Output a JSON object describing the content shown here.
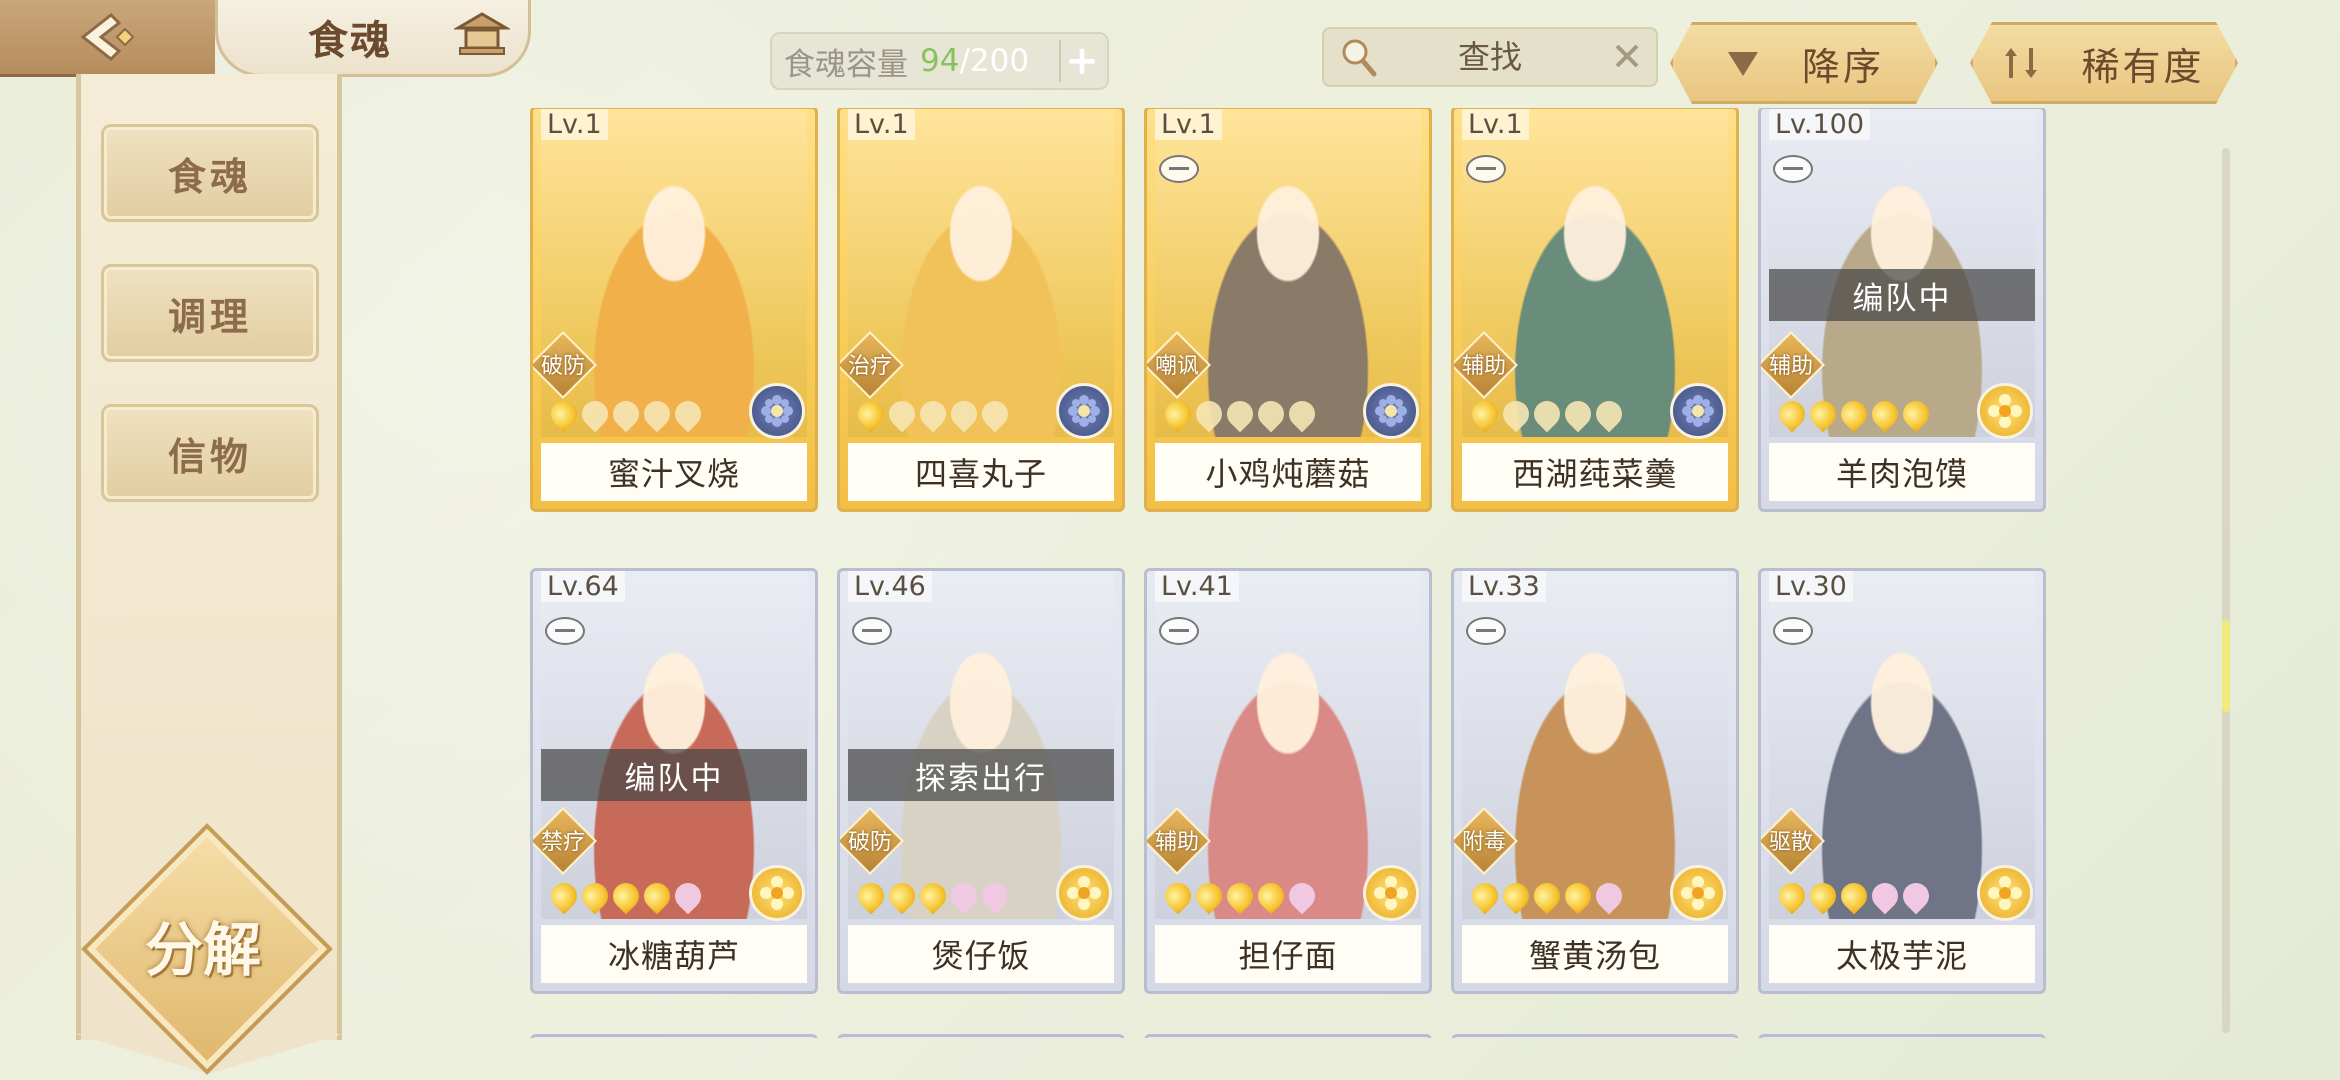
{
  "header": {
    "title": "食魂",
    "capacity_label": "食魂容量",
    "capacity_current": "94",
    "capacity_sep": "/",
    "capacity_max": "200",
    "plus_label": "+",
    "search_placeholder": "查找",
    "sort_desc_label": "降序",
    "sort_rarity_label": "稀有度"
  },
  "sidebar": {
    "tabs": [
      {
        "label": "食魂",
        "active": true
      },
      {
        "label": "调理",
        "active": false
      },
      {
        "label": "信物",
        "active": false
      }
    ],
    "decompose_label": "分解"
  },
  "cards": [
    {
      "level": "Lv.1",
      "name": "蜜汁叉烧",
      "role": "破防",
      "frame": "gold",
      "stars_on": 1,
      "stars_total": 5,
      "element": "blue",
      "status": "",
      "skin": false,
      "art": "#f2b04a"
    },
    {
      "level": "Lv.1",
      "name": "四喜丸子",
      "role": "治疗",
      "frame": "gold",
      "stars_on": 1,
      "stars_total": 5,
      "element": "blue",
      "status": "",
      "skin": false,
      "art": "#f1c25a"
    },
    {
      "level": "Lv.1",
      "name": "小鸡炖蘑菇",
      "role": "嘲讽",
      "frame": "gold",
      "stars_on": 1,
      "stars_total": 5,
      "element": "blue",
      "status": "",
      "skin": true,
      "art": "#8a7a68"
    },
    {
      "level": "Lv.1",
      "name": "西湖莼菜羹",
      "role": "辅助",
      "frame": "gold",
      "stars_on": 1,
      "stars_total": 5,
      "element": "blue",
      "status": "",
      "skin": true,
      "art": "#6a8c7a"
    },
    {
      "level": "Lv.100",
      "name": "羊肉泡馍",
      "role": "辅助",
      "frame": "silver",
      "stars_on": 5,
      "stars_total": 5,
      "element": "gold",
      "status": "编队中",
      "skin": true,
      "art": "#b8a98a"
    },
    {
      "level": "Lv.64",
      "name": "冰糖葫芦",
      "role": "禁疗",
      "frame": "silver",
      "stars_on": 4,
      "stars_total": 5,
      "element": "gold",
      "status": "编队中",
      "skin": true,
      "art": "#c86a5a"
    },
    {
      "level": "Lv.46",
      "name": "煲仔饭",
      "role": "破防",
      "frame": "silver",
      "stars_on": 3,
      "stars_total": 5,
      "element": "gold",
      "status": "探索出行",
      "skin": true,
      "art": "#d8d2c4"
    },
    {
      "level": "Lv.41",
      "name": "担仔面",
      "role": "辅助",
      "frame": "silver",
      "stars_on": 4,
      "stars_total": 5,
      "element": "gold",
      "status": "",
      "skin": true,
      "art": "#d98a86"
    },
    {
      "level": "Lv.33",
      "name": "蟹黄汤包",
      "role": "附毒",
      "frame": "silver",
      "stars_on": 4,
      "stars_total": 5,
      "element": "gold",
      "status": "",
      "skin": true,
      "art": "#c7935a"
    },
    {
      "level": "Lv.30",
      "name": "太极芋泥",
      "role": "驱散",
      "frame": "silver",
      "stars_on": 3,
      "stars_total": 5,
      "element": "gold",
      "status": "",
      "skin": true,
      "art": "#6f7486"
    }
  ]
}
